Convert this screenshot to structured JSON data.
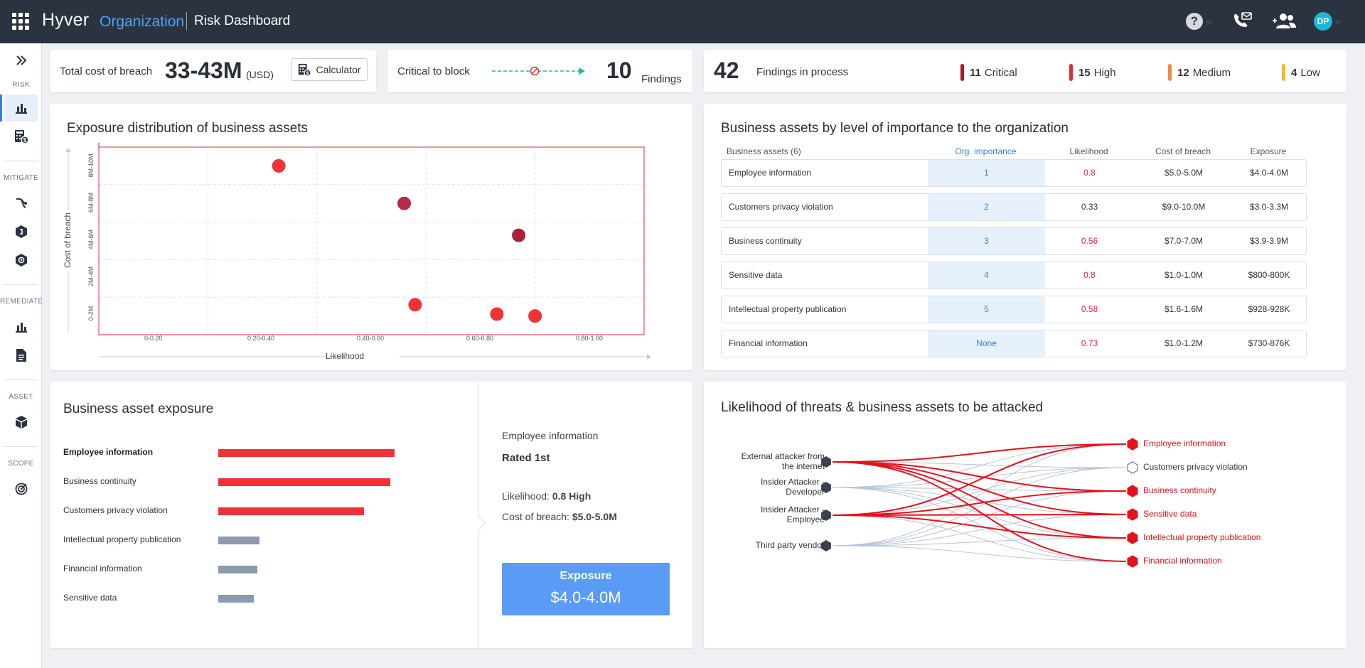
{
  "header": {
    "brand": "Hyver",
    "org": "Organization",
    "title": "Risk Dashboard",
    "avatar": "DP",
    "help": "?"
  },
  "sidebar": {
    "sections": [
      "RISK",
      "MITIGATE",
      "REMEDIATE",
      "ASSET",
      "SCOPE"
    ]
  },
  "stats": {
    "cost": {
      "label": "Total cost of breach",
      "value": "33-43M",
      "unit": "(USD)",
      "button": "Calculator"
    },
    "critical": {
      "label": "Critical to block",
      "count": "10",
      "unit": "Findings"
    },
    "process": {
      "count": "42",
      "label": "Findings in process",
      "severities": [
        {
          "count": "11",
          "label": "Critical",
          "color": "#b0162a"
        },
        {
          "count": "15",
          "label": "High",
          "color": "#e52935"
        },
        {
          "count": "12",
          "label": "Medium",
          "color": "#f5883a"
        },
        {
          "count": "4",
          "label": "Low",
          "color": "#f5b82e"
        }
      ]
    }
  },
  "exposure_distribution": {
    "title": "Exposure distribution of business assets",
    "xlabel": "Likelihood",
    "ylabel": "Cost of breach",
    "xticks": [
      "0-0.20",
      "0.20-0.40",
      "0.40-0.60",
      "0.60-0.80",
      "0.80-1.00"
    ],
    "yticks": [
      "8M-10M",
      "6M-8M",
      "4M-6M",
      "2M-4M",
      "0-2M"
    ]
  },
  "chart_data": {
    "type": "scatter",
    "title": "Exposure distribution of business assets",
    "xlabel": "Likelihood",
    "ylabel": "Cost of breach",
    "xlim": [
      0,
      1
    ],
    "ylim": [
      0,
      10
    ],
    "points": [
      {
        "x": 0.33,
        "y": 9.0,
        "color": "#ee3338"
      },
      {
        "x": 0.56,
        "y": 7.0,
        "color": "#b5294a"
      },
      {
        "x": 0.77,
        "y": 5.3,
        "color": "#a8203a"
      },
      {
        "x": 0.58,
        "y": 1.6,
        "color": "#ee3338"
      },
      {
        "x": 0.73,
        "y": 1.1,
        "color": "#ee3338"
      },
      {
        "x": 0.8,
        "y": 1.0,
        "color": "#ee3338"
      }
    ]
  },
  "importance": {
    "title": "Business assets by level of importance to the organization",
    "headers": [
      "Business assets (6)",
      "Org. importance",
      "Likelihood",
      "Cost of breach",
      "Exposure"
    ],
    "rows": [
      {
        "name": "Employee information",
        "imp": "1",
        "lik": "0.8",
        "cost": "$5.0-5.0M",
        "exp": "$4.0-4.0M",
        "red": true
      },
      {
        "name": "Customers privacy violation",
        "imp": "2",
        "lik": "0.33",
        "cost": "$9.0-10.0M",
        "exp": "$3.0-3.3M",
        "red": false
      },
      {
        "name": "Business continuity",
        "imp": "3",
        "lik": "0.56",
        "cost": "$7.0-7.0M",
        "exp": "$3.9-3.9M",
        "red": true
      },
      {
        "name": "Sensitive data",
        "imp": "4",
        "lik": "0.8",
        "cost": "$1.0-1.0M",
        "exp": "$800-800K",
        "red": true
      },
      {
        "name": "Intellectual property publication",
        "imp": "5",
        "lik": "0.58",
        "cost": "$1.6-1.6M",
        "exp": "$928-928K",
        "red": true
      },
      {
        "name": "Financial information",
        "imp": "None",
        "lik": "0.73",
        "cost": "$1.0-1.2M",
        "exp": "$730-876K",
        "red": true
      }
    ]
  },
  "asset_exposure": {
    "title": "Business asset exposure",
    "items": [
      {
        "name": "Employee information",
        "value": 4.0,
        "color": "#ee3338",
        "selected": true
      },
      {
        "name": "Business continuity",
        "value": 3.9,
        "color": "#ee3338",
        "selected": false
      },
      {
        "name": "Customers privacy violation",
        "value": 3.3,
        "color": "#ee3338",
        "selected": false
      },
      {
        "name": "Intellectual property publication",
        "value": 0.93,
        "color": "#8d9bb0",
        "selected": false
      },
      {
        "name": "Financial information",
        "value": 0.88,
        "color": "#8d9bb0",
        "selected": false
      },
      {
        "name": "Sensitive data",
        "value": 0.8,
        "color": "#8d9bb0",
        "selected": false
      }
    ],
    "max": 4.0,
    "detail": {
      "name": "Employee information",
      "rated": "Rated 1st",
      "likelihood_label": "Likelihood:",
      "likelihood_value": "0.8 High",
      "cost_label": "Cost of breach:",
      "cost_value": "$5.0-5.0M",
      "exposure_label": "Exposure",
      "exposure_value": "$4.0-4.0M"
    }
  },
  "threats": {
    "title": "Likelihood of threats & business assets to be attacked",
    "sources": [
      {
        "line1": "External attacker from",
        "line2": "the internet"
      },
      {
        "line1": "Insider Attacker -",
        "line2": "Developer"
      },
      {
        "line1": "Insider Attacker -",
        "line2": "Employee"
      },
      {
        "line1": "Third party vendor",
        "line2": ""
      }
    ],
    "targets": [
      {
        "name": "Employee information",
        "red": true
      },
      {
        "name": "Customers privacy violation",
        "red": false
      },
      {
        "name": "Business continuity",
        "red": true
      },
      {
        "name": "Sensitive data",
        "red": true
      },
      {
        "name": "Intellectual property publication",
        "red": true
      },
      {
        "name": "Financial information",
        "red": true
      }
    ],
    "red_links": [
      [
        0,
        0
      ],
      [
        0,
        2
      ],
      [
        0,
        3
      ],
      [
        0,
        4
      ],
      [
        0,
        5
      ],
      [
        2,
        0
      ],
      [
        2,
        2
      ],
      [
        2,
        3
      ],
      [
        2,
        4
      ]
    ]
  }
}
